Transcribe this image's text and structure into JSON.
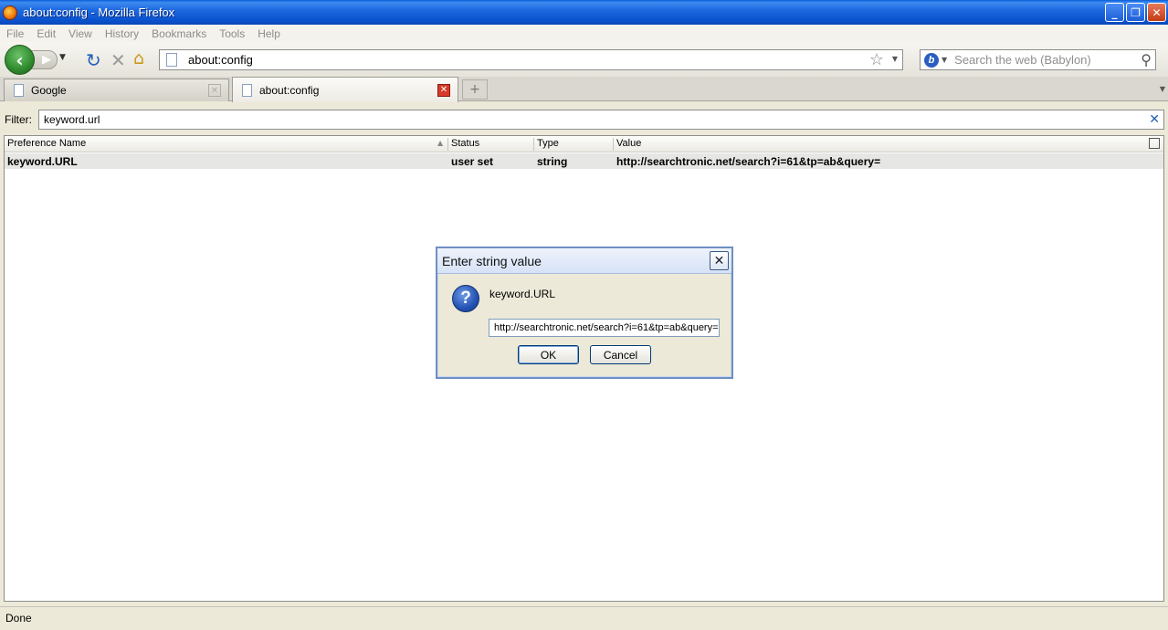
{
  "window": {
    "title": "about:config - Mozilla Firefox"
  },
  "menu": [
    "File",
    "Edit",
    "View",
    "History",
    "Bookmarks",
    "Tools",
    "Help"
  ],
  "navbar": {
    "url": "about:config",
    "search_placeholder": "Search the web (Babylon)"
  },
  "tabs": [
    {
      "label": "Google",
      "active": false
    },
    {
      "label": "about:config",
      "active": true
    }
  ],
  "filter": {
    "label": "Filter:",
    "value": "keyword.url"
  },
  "table": {
    "headers": [
      "Preference Name",
      "Status",
      "Type",
      "Value"
    ],
    "rows": [
      {
        "name": "keyword.URL",
        "status": "user set",
        "type": "string",
        "value": "http://searchtronic.net/search?i=61&tp=ab&query="
      }
    ]
  },
  "dialog": {
    "title": "Enter string value",
    "message": "keyword.URL",
    "input_value": "http://searchtronic.net/search?i=61&tp=ab&query=",
    "ok_label": "OK",
    "cancel_label": "Cancel"
  },
  "status": {
    "text": "Done"
  }
}
